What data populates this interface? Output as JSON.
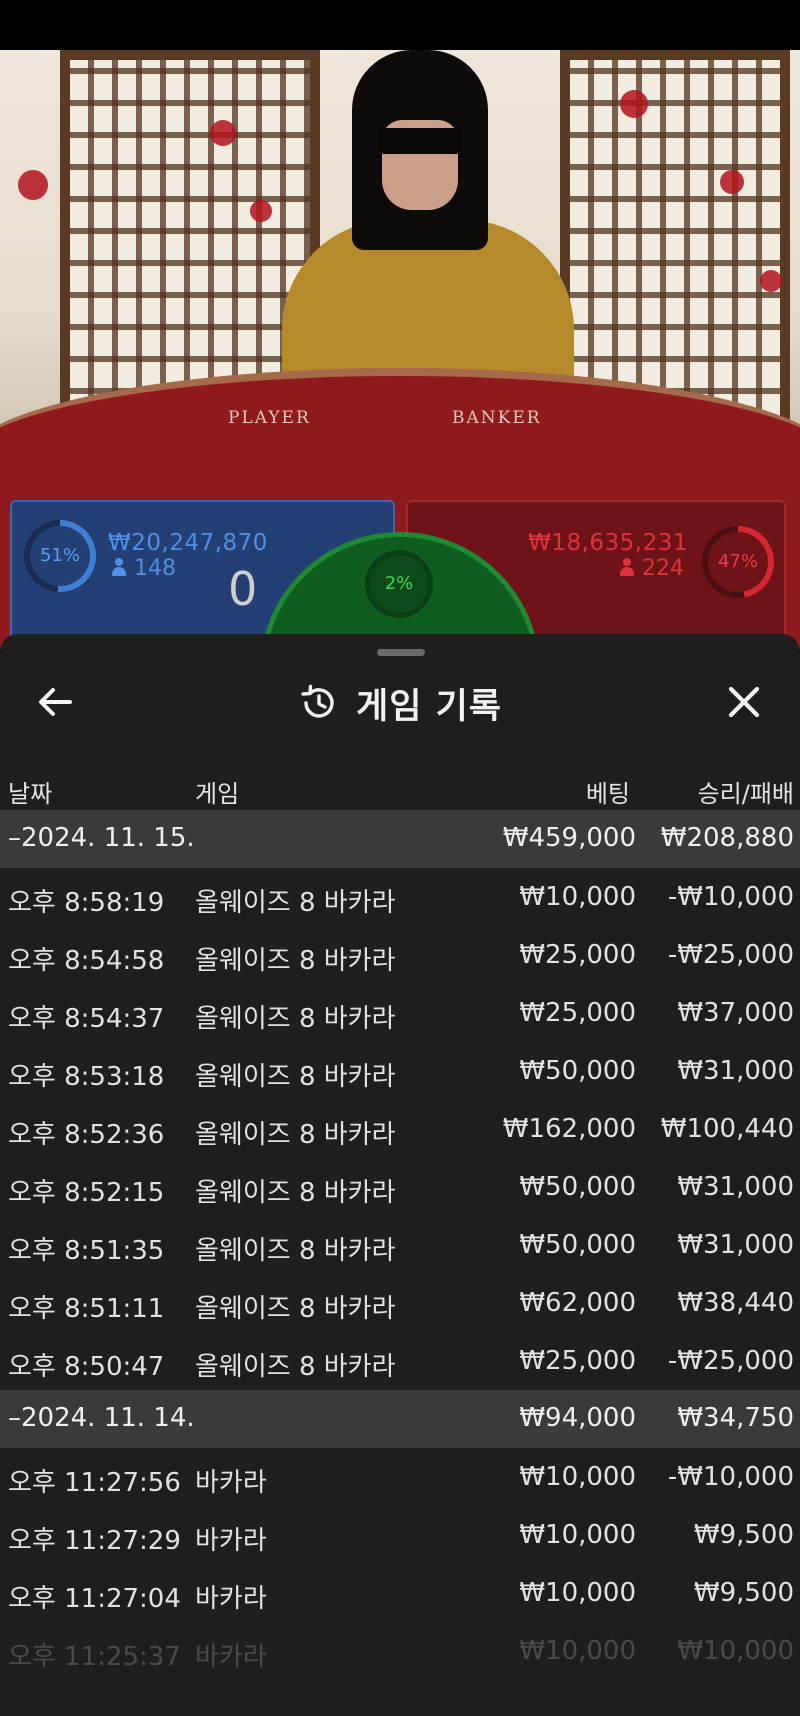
{
  "stats": {
    "player_pct": "51%",
    "player_amount": "₩20,247,870",
    "player_count": "148",
    "player_score": "0",
    "tie_pct": "2%",
    "banker_amount": "₩18,635,231",
    "banker_count": "224",
    "banker_pct": "47%"
  },
  "table_labels": {
    "player": "PLAYER",
    "banker": "BANKER"
  },
  "colors": {
    "player": "#3f7fd6",
    "banker": "#d6262f",
    "tie": "#22b83e",
    "sheet_bg": "#1e1e1e",
    "group_row_bg": "#3a3a3a"
  },
  "header": {
    "back_icon": "arrow-left-icon",
    "history_icon": "history-icon",
    "title": "게임 기록",
    "close_icon": "close-icon"
  },
  "columns": {
    "date": "날짜",
    "game": "게임",
    "bet": "베팅",
    "result": "승리/패배"
  },
  "groups": [
    {
      "date": "–2024. 11. 15.",
      "bet": "₩459,000",
      "result": "₩208,880",
      "rows": [
        {
          "time": "오후 8:58:19",
          "game": "올웨이즈 8 바카라",
          "bet": "₩10,000",
          "result": "-₩10,000"
        },
        {
          "time": "오후 8:54:58",
          "game": "올웨이즈 8 바카라",
          "bet": "₩25,000",
          "result": "-₩25,000"
        },
        {
          "time": "오후 8:54:37",
          "game": "올웨이즈 8 바카라",
          "bet": "₩25,000",
          "result": "₩37,000"
        },
        {
          "time": "오후 8:53:18",
          "game": "올웨이즈 8 바카라",
          "bet": "₩50,000",
          "result": "₩31,000"
        },
        {
          "time": "오후 8:52:36",
          "game": "올웨이즈 8 바카라",
          "bet": "₩162,000",
          "result": "₩100,440"
        },
        {
          "time": "오후 8:52:15",
          "game": "올웨이즈 8 바카라",
          "bet": "₩50,000",
          "result": "₩31,000"
        },
        {
          "time": "오후 8:51:35",
          "game": "올웨이즈 8 바카라",
          "bet": "₩50,000",
          "result": "₩31,000"
        },
        {
          "time": "오후 8:51:11",
          "game": "올웨이즈 8 바카라",
          "bet": "₩62,000",
          "result": "₩38,440"
        },
        {
          "time": "오후 8:50:47",
          "game": "올웨이즈 8 바카라",
          "bet": "₩25,000",
          "result": "-₩25,000"
        }
      ]
    },
    {
      "date": "–2024. 11. 14.",
      "bet": "₩94,000",
      "result": "₩34,750",
      "rows": [
        {
          "time": "오후 11:27:56",
          "game": "바카라",
          "bet": "₩10,000",
          "result": "-₩10,000"
        },
        {
          "time": "오후 11:27:29",
          "game": "바카라",
          "bet": "₩10,000",
          "result": "₩9,500"
        },
        {
          "time": "오후 11:27:04",
          "game": "바카라",
          "bet": "₩10,000",
          "result": "₩9,500"
        },
        {
          "time": "오후 11:25:37",
          "game": "바카라",
          "bet": "₩10,000",
          "result": "₩10,000"
        }
      ]
    }
  ]
}
